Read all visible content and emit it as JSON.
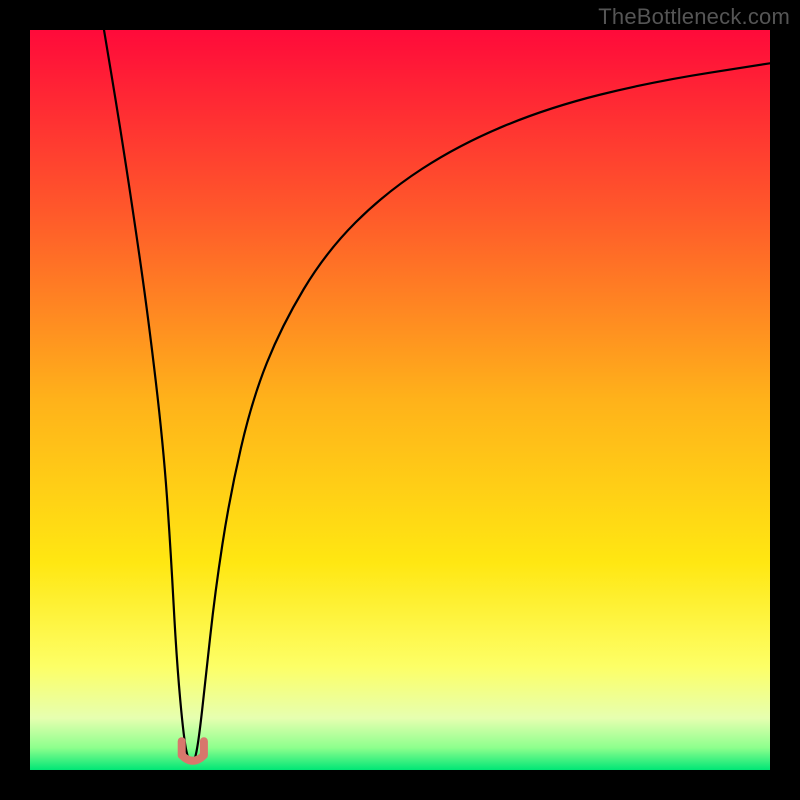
{
  "watermark": "TheBottleneck.com",
  "chart_data": {
    "type": "line",
    "title": "",
    "xlabel": "",
    "ylabel": "",
    "xlim": [
      0,
      100
    ],
    "ylim": [
      0,
      100
    ],
    "grid": false,
    "background_gradient": {
      "direction": "vertical",
      "stops": [
        {
          "pos": 0.0,
          "color": "#ff0a3a"
        },
        {
          "pos": 0.25,
          "color": "#ff5a2a"
        },
        {
          "pos": 0.5,
          "color": "#ffb21a"
        },
        {
          "pos": 0.72,
          "color": "#ffe712"
        },
        {
          "pos": 0.86,
          "color": "#fdff66"
        },
        {
          "pos": 0.93,
          "color": "#e6ffb0"
        },
        {
          "pos": 0.97,
          "color": "#8dff8d"
        },
        {
          "pos": 1.0,
          "color": "#00e676"
        }
      ]
    },
    "series": [
      {
        "name": "bottleneck-curve",
        "color": "#000000",
        "width": 2.2,
        "x": [
          10,
          12,
          14,
          16,
          18,
          19,
          19.8,
          20.8,
          21.5,
          22.2,
          22.8,
          23.7,
          25,
          27,
          30,
          34,
          40,
          48,
          58,
          70,
          84,
          100
        ],
        "values": [
          100,
          88,
          75,
          61,
          44,
          30,
          15,
          4,
          1,
          1,
          4,
          12,
          24,
          37,
          50,
          60,
          70,
          78,
          84.5,
          89.5,
          93,
          95.5
        ]
      }
    ],
    "annotations": [
      {
        "name": "trough-marker",
        "type": "u-shape",
        "color": "#d8776c",
        "x_center": 22,
        "y_center": 2,
        "width": 3,
        "stroke_width": 8
      }
    ]
  }
}
